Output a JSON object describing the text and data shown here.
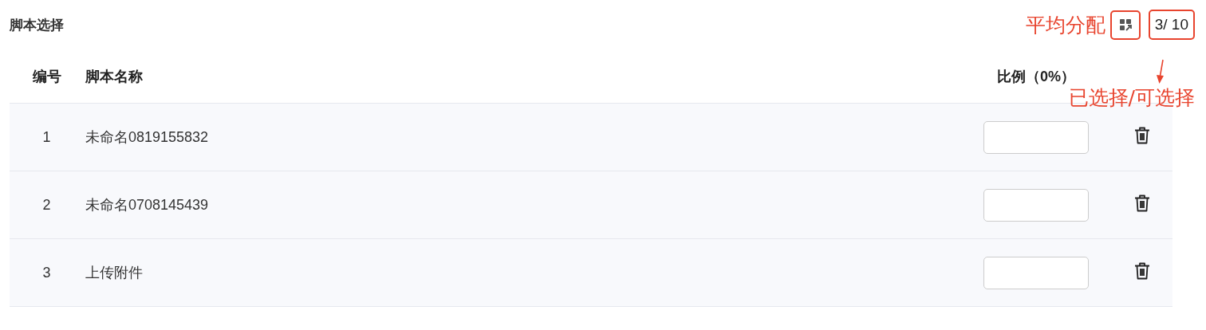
{
  "title": "脚本选择",
  "toolbar": {
    "annotation": "平均分配",
    "counter": "3/ 10",
    "counter_annotation": "已选择/可选择"
  },
  "table": {
    "columns": [
      "编号",
      "脚本名称",
      "比例（0%）"
    ],
    "rows": [
      {
        "number": "1",
        "name": "未命名0819155832"
      },
      {
        "number": "2",
        "name": "未命名0708145439"
      },
      {
        "number": "3",
        "name": "上传附件"
      }
    ]
  }
}
